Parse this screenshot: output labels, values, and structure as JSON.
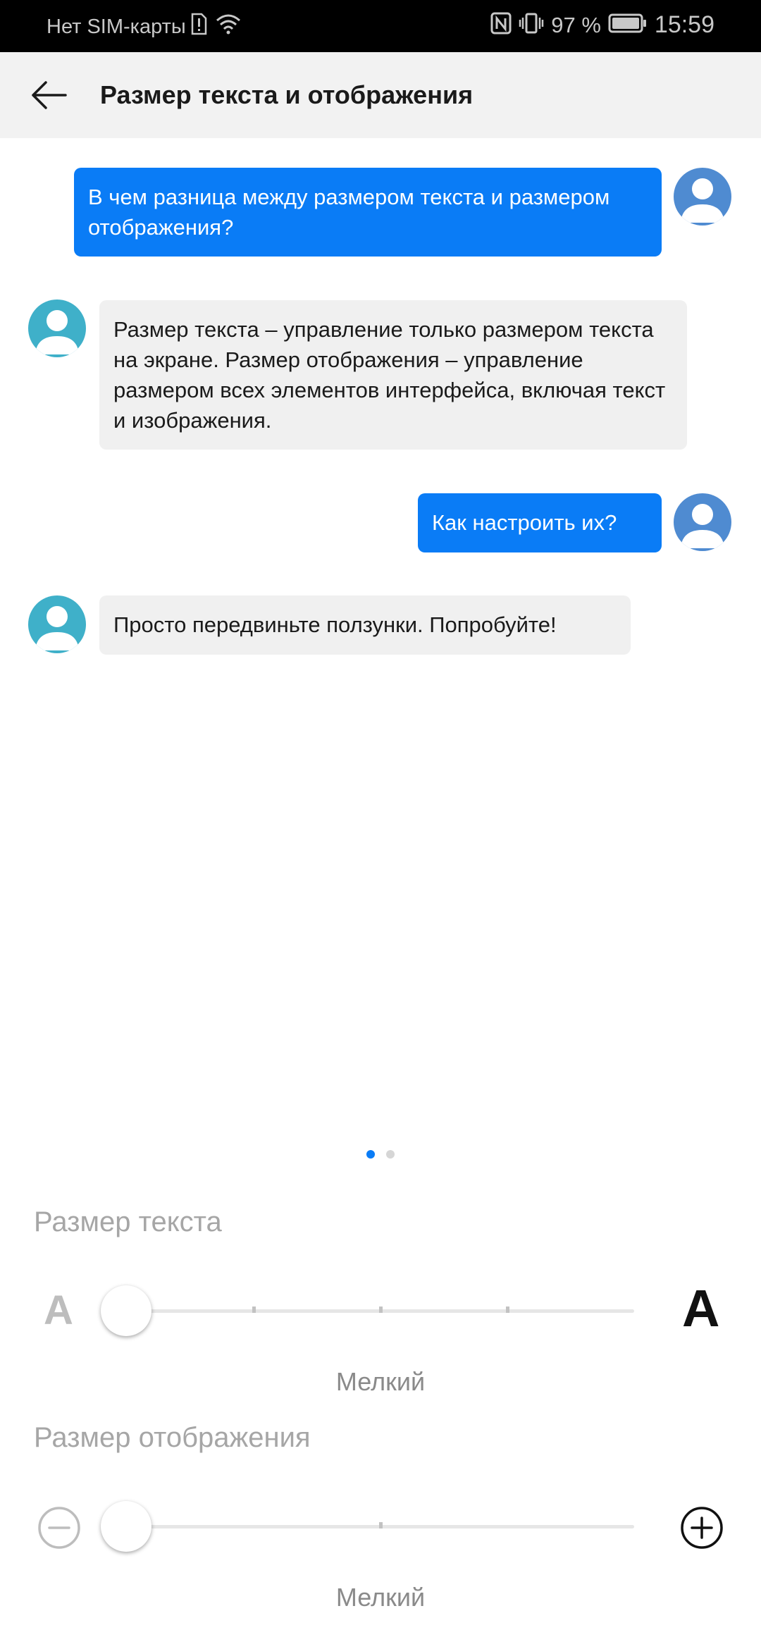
{
  "status_bar": {
    "carrier": "Нет SIM-карты",
    "battery_percent": "97 %",
    "time": "15:59"
  },
  "app_bar": {
    "title": "Размер текста и отображения"
  },
  "chat": {
    "messages": [
      {
        "from": "user",
        "text": "В чем разница между размером текста и размером отображения?"
      },
      {
        "from": "bot",
        "text": "Размер текста – управление только размером текста на экране. Размер отображения – управление размером всех элементов интерфейса, включая текст и изображения."
      },
      {
        "from": "user",
        "text": "Как настроить их?"
      },
      {
        "from": "bot",
        "text": "Просто передвиньте ползунки. Попробуйте!"
      }
    ]
  },
  "pager": {
    "pages": 2,
    "current": 1
  },
  "text_size": {
    "label": "Размер текста",
    "small_glyph": "A",
    "large_glyph": "A",
    "value": "Мелкий",
    "steps": 5,
    "position": 0
  },
  "display_size": {
    "label": "Размер отображения",
    "value": "Мелкий",
    "steps": 3,
    "position": 0
  },
  "colors": {
    "accent": "#0a7cf6",
    "user_avatar": "#4f8bd1",
    "bot_avatar": "#3fb0c9"
  }
}
